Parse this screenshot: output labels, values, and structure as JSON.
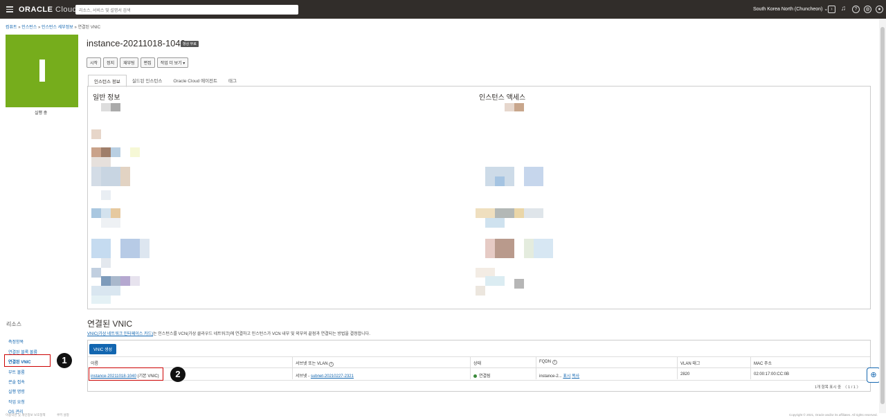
{
  "topbar": {
    "brand": "ORACLE",
    "brand_sub": "Cloud",
    "search_placeholder": "리소스, 서비스 및 설명서 검색",
    "region": "South Korea North (Chuncheon)",
    "region_chevron": "⌄"
  },
  "breadcrumb": {
    "items": [
      "컴퓨트",
      "인스턴스",
      "인스턴스 세부정보"
    ],
    "separator": " » ",
    "current": "연결된 VNIC"
  },
  "instance": {
    "tile_color": "#76ad1c",
    "status": "실행 중",
    "name": "instance-20211018-1040",
    "badge": "항상 무료",
    "actions": [
      "시작",
      "정지",
      "재부팅",
      "편집"
    ],
    "more_actions": "작업 더 보기 ▾"
  },
  "tabs": [
    "인스턴스 정보",
    "실드된 인스턴스",
    "Oracle Cloud 에이전트",
    "태그"
  ],
  "panel": {
    "general_title": "일반 정보",
    "access_title": "인스턴스 액세스"
  },
  "resources": {
    "title": "리소스",
    "items": [
      "측정항목",
      "연결된 블록 볼륨",
      "연결된 VNIC",
      "부트 볼륨",
      "콘솔 접속",
      "실행 명령",
      "작업 요청",
      "OS 관리"
    ]
  },
  "vnic": {
    "title": "연결된 VNIC",
    "desc_link": "VNIC(가상 네트워크 인터페이스 카드)",
    "desc_rest": "는 인스턴스를 VCN(가상 클라우드 네트워크)에 연결하고 인스턴스가 VCN 내부 및 외부의 끝점과 연결되는 방법을 결정합니다.",
    "create_button": "VNIC 생성",
    "columns": [
      "이름",
      "서브넷 또는 VLAN",
      "상태",
      "FQDN",
      "VLAN 태그",
      "MAC 주소"
    ],
    "row": {
      "name_link": "instance-20211018-1040",
      "name_suffix": " (기본 VNIC)",
      "subnet_prefix": "서브넷 - ",
      "subnet_link": "subnet-20210227-2321",
      "status": "연결됨",
      "status_color": "#3a8a3a",
      "fqdn": "instance-2...",
      "fqdn_show": "표시",
      "fqdn_copy": "복사",
      "vlan_tag": "2820",
      "mac": "02:00:17:00:CC:0B"
    },
    "footer_text": "1개 항목 표시 중",
    "pager": "1 / 1"
  },
  "annotations": {
    "one": "1",
    "two": "2"
  },
  "footer": {
    "left": "이용약관 및 개인정보 보호정책",
    "left2": "쿠키 설정",
    "right": "Copyright © 2021, Oracle and/or its affiliates. All rights reserved."
  },
  "colors": {
    "brand_dark": "#312d2a",
    "link": "#1266b0",
    "highlight": "#cc0000"
  }
}
